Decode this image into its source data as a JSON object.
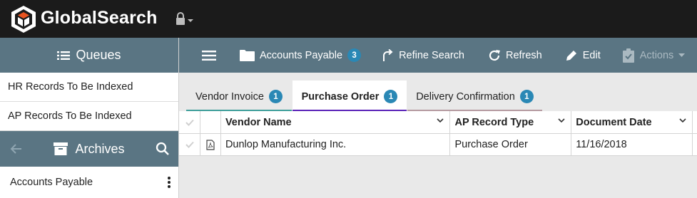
{
  "app": {
    "title": "GlobalSearch"
  },
  "icons": {
    "logo": "globalsearch-logo-icon",
    "lock": "lock-icon",
    "queues": "list-icon",
    "archives": "archive-box-icon",
    "back": "arrow-left-icon",
    "search": "search-icon",
    "more": "kebab-vertical-icon",
    "menu": "hamburger-icon",
    "folder": "folder-icon",
    "refine": "refine-arrow-icon",
    "refresh": "refresh-icon",
    "edit": "pencil-icon",
    "actions": "clipboard-check-icon",
    "pdf": "pdf-file-icon"
  },
  "sidebar": {
    "queues_title": "Queues",
    "queues": [
      {
        "label": "HR Records To Be Indexed"
      },
      {
        "label": "AP Records To Be Indexed"
      }
    ],
    "archives_title": "Archives",
    "archives": [
      {
        "label": "Accounts Payable"
      }
    ]
  },
  "toolbar": {
    "archive_label": "Accounts Payable",
    "archive_count": "3",
    "refine_label": "Refine Search",
    "refresh_label": "Refresh",
    "edit_label": "Edit",
    "actions_label": "Actions"
  },
  "tabs": [
    {
      "label": "Vendor Invoice",
      "count": "1",
      "color": "#3e9e9a"
    },
    {
      "label": "Purchase Order",
      "count": "1",
      "color": "#5a22b8",
      "active": true
    },
    {
      "label": "Delivery Confirmation",
      "count": "1",
      "color": "#b59aa0"
    }
  ],
  "grid": {
    "columns": [
      "Vendor Name",
      "AP Record Type",
      "Document Date"
    ],
    "rows": [
      {
        "vendor_name": "Dunlop Manufacturing Inc.",
        "record_type": "Purchase Order",
        "document_date": "11/16/2018"
      }
    ]
  },
  "colors": {
    "topbar": "#1b1b1b",
    "panel": "#5a7583",
    "badge": "#2a88b5"
  }
}
